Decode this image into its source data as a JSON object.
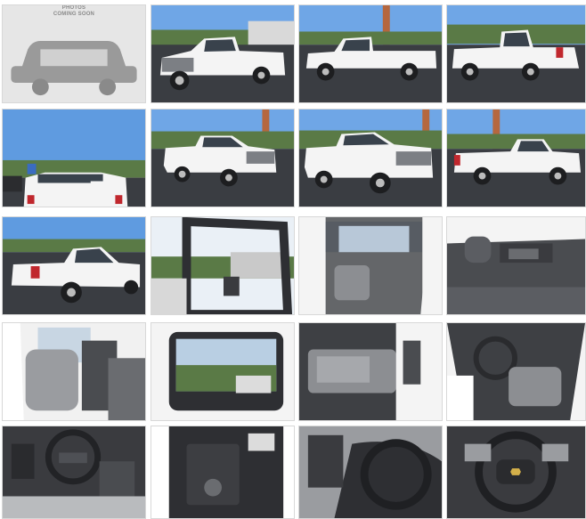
{
  "gallery": {
    "placeholder": {
      "line1": "PHOTOS",
      "line2": "COMING SOON",
      "icon": "car-icon"
    },
    "photos": [
      {
        "kind": "front-left"
      },
      {
        "kind": "side-left"
      },
      {
        "kind": "rear-left"
      },
      {
        "kind": "rear-lot"
      },
      {
        "kind": "front-right"
      },
      {
        "kind": "front-right-close"
      },
      {
        "kind": "side-right"
      },
      {
        "kind": "rear-right"
      },
      {
        "kind": "door-open"
      },
      {
        "kind": "interior-seat"
      },
      {
        "kind": "dashboard"
      },
      {
        "kind": "seats-side"
      },
      {
        "kind": "door-window"
      },
      {
        "kind": "door-panel"
      },
      {
        "kind": "cabin-seat"
      },
      {
        "kind": "dash-steering"
      },
      {
        "kind": "console-controls"
      },
      {
        "kind": "steering-column"
      },
      {
        "kind": "steering-wheel"
      }
    ]
  },
  "colors": {
    "sky": "#5f9be0",
    "asphalt": "#3a3d42",
    "truck": "#f4f4f4",
    "interior": "#4a4c50",
    "trees": "#4f6a3a"
  }
}
